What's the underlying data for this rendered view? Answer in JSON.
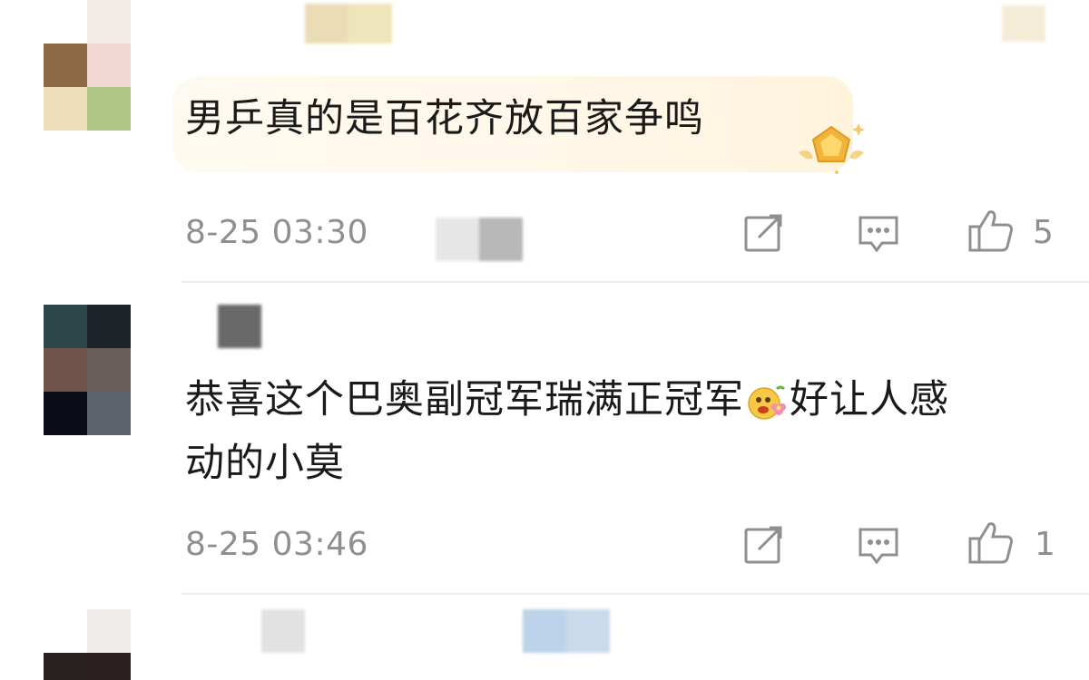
{
  "comments": [
    {
      "text": "男乒真的是百花齐放百家争鸣",
      "time": "8-25 03:30",
      "likes": "5",
      "badge_icon": "gold-pentagon-badge-icon"
    },
    {
      "text_line1_part1": "恭喜这个巴奥副冠军瑞满正冠军",
      "emoji_icon": "flower-smile-emoji-icon",
      "text_line1_part2": "好让人感",
      "text_line2": "动的小莫",
      "time": "8-25 03:46",
      "likes": "1"
    }
  ],
  "icons": {
    "share": "share-icon",
    "comment": "comment-icon",
    "like": "thumbs-up-icon"
  },
  "colors": {
    "text": "#1a1a1a",
    "meta": "#8f8f8f",
    "divider": "#ececec",
    "bubble": "#fff6e6"
  }
}
